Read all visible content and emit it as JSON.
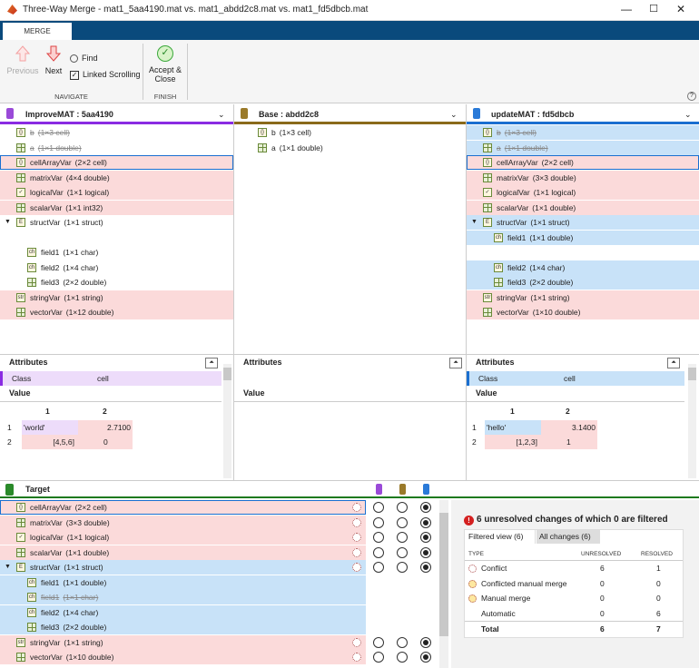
{
  "window": {
    "title": "Three-Way Merge - mat1_5aa4190.mat vs. mat1_abdd2c8.mat vs. mat1_fd5dbcb.mat"
  },
  "tabs": {
    "merge": "MERGE"
  },
  "toolbar": {
    "previous": "Previous",
    "next": "Next",
    "find": "Find",
    "linked_scrolling": "Linked Scrolling",
    "accept_close": "Accept &",
    "accept_close2": "Close",
    "navigate": "NAVIGATE",
    "finish": "FINISH"
  },
  "left": {
    "title": "ImproveMAT : 5aa4190",
    "rows": [
      {
        "name": "b",
        "type": "(1×3 cell)",
        "cls": "strike",
        "bg": ""
      },
      {
        "name": "a",
        "type": "(1×1 double)",
        "cls": "strike",
        "bg": ""
      },
      {
        "name": "cellArrayVar",
        "type": "(2×2 cell)",
        "cls": "",
        "bg": "pink"
      },
      {
        "name": "matrixVar",
        "type": "(4×4 double)",
        "cls": "",
        "bg": "pink"
      },
      {
        "name": "logicalVar",
        "type": "(1×1 logical)",
        "cls": "",
        "bg": "pink"
      },
      {
        "name": "scalarVar",
        "type": "(1×1 int32)",
        "cls": "",
        "bg": "pink"
      },
      {
        "name": "structVar",
        "type": "(1×1 struct)",
        "cls": "",
        "bg": ""
      },
      {
        "name": "",
        "type": "",
        "cls": "",
        "bg": ""
      },
      {
        "name": "field1",
        "type": "(1×1 char)",
        "cls": "",
        "bg": ""
      },
      {
        "name": "field2",
        "type": "(1×4 char)",
        "cls": "",
        "bg": ""
      },
      {
        "name": "field3",
        "type": "(2×2 double)",
        "cls": "",
        "bg": ""
      },
      {
        "name": "stringVar",
        "type": "(1×1 string)",
        "cls": "",
        "bg": "pink"
      },
      {
        "name": "vectorVar",
        "type": "(1×12 double)",
        "cls": "",
        "bg": "pink"
      }
    ],
    "attributes": "Attributes",
    "class_label": "Class",
    "class_value": "cell",
    "value_label": "Value",
    "grid_cols": [
      "1",
      "2"
    ],
    "grid_rows": [
      [
        "1",
        "'world'",
        "2.7100"
      ],
      [
        "2",
        "[4,5,6]",
        "0"
      ]
    ]
  },
  "base": {
    "title": "Base : abdd2c8",
    "rows": [
      {
        "name": "b",
        "type": "(1×3 cell)"
      },
      {
        "name": "a",
        "type": "(1×1 double)"
      }
    ],
    "attributes": "Attributes",
    "value_label": "Value"
  },
  "right": {
    "title": "updateMAT : fd5dbcb",
    "rows": [
      {
        "name": "b",
        "type": "(1×3 cell)",
        "cls": "strike",
        "bg": "blue"
      },
      {
        "name": "a",
        "type": "(1×1 double)",
        "cls": "strike",
        "bg": "blue"
      },
      {
        "name": "cellArrayVar",
        "type": "(2×2 cell)",
        "cls": "",
        "bg": "pink"
      },
      {
        "name": "matrixVar",
        "type": "(3×3 double)",
        "cls": "",
        "bg": "pink"
      },
      {
        "name": "logicalVar",
        "type": "(1×1 logical)",
        "cls": "",
        "bg": "pink"
      },
      {
        "name": "scalarVar",
        "type": "(1×1 double)",
        "cls": "",
        "bg": "pink"
      },
      {
        "name": "structVar",
        "type": "(1×1 struct)",
        "cls": "",
        "bg": "blue"
      },
      {
        "name": "field1",
        "type": "(1×1 double)",
        "cls": "",
        "bg": "blue"
      },
      {
        "name": "",
        "type": "",
        "cls": "",
        "bg": ""
      },
      {
        "name": "field2",
        "type": "(1×4 char)",
        "cls": "",
        "bg": "blue"
      },
      {
        "name": "field3",
        "type": "(2×2 double)",
        "cls": "",
        "bg": "blue"
      },
      {
        "name": "stringVar",
        "type": "(1×1 string)",
        "cls": "",
        "bg": "pink"
      },
      {
        "name": "vectorVar",
        "type": "(1×10 double)",
        "cls": "",
        "bg": "pink"
      }
    ],
    "attributes": "Attributes",
    "class_label": "Class",
    "class_value": "cell",
    "value_label": "Value",
    "grid_cols": [
      "1",
      "2"
    ],
    "grid_rows": [
      [
        "1",
        "'hello'",
        "3.1400"
      ],
      [
        "2",
        "[1,2,3]",
        "1"
      ]
    ]
  },
  "target": {
    "title": "Target",
    "rows": [
      {
        "name": "cellArrayVar",
        "type": "(2×2 cell)",
        "cls": "",
        "bg": "pink",
        "sel": 2
      },
      {
        "name": "matrixVar",
        "type": "(3×3 double)",
        "cls": "",
        "bg": "pink",
        "sel": 2
      },
      {
        "name": "logicalVar",
        "type": "(1×1 logical)",
        "cls": "",
        "bg": "pink",
        "sel": 2
      },
      {
        "name": "scalarVar",
        "type": "(1×1 double)",
        "cls": "",
        "bg": "pink",
        "sel": 2
      },
      {
        "name": "structVar",
        "type": "(1×1 struct)",
        "cls": "",
        "bg": "blue",
        "sel": 2
      },
      {
        "name": "field1",
        "type": "(1×1 double)",
        "cls": "",
        "bg": "blue",
        "sel": -1
      },
      {
        "name": "field1",
        "type": "(1×1 char)",
        "cls": "strike",
        "bg": "blue",
        "sel": -1
      },
      {
        "name": "field2",
        "type": "(1×4 char)",
        "cls": "",
        "bg": "blue",
        "sel": -1
      },
      {
        "name": "field3",
        "type": "(2×2 double)",
        "cls": "",
        "bg": "blue",
        "sel": -1
      },
      {
        "name": "stringVar",
        "type": "(1×1 string)",
        "cls": "",
        "bg": "pink",
        "sel": 2
      },
      {
        "name": "vectorVar",
        "type": "(1×10 double)",
        "cls": "",
        "bg": "pink",
        "sel": 2
      }
    ]
  },
  "summary": {
    "headline": "6 unresolved changes of which 0 are filtered",
    "tab_filtered": "Filtered view (6)",
    "tab_all": "All changes (6)",
    "col_type": "TYPE",
    "col_unresolved": "UNRESOLVED",
    "col_resolved": "RESOLVED",
    "rows": [
      {
        "type": "Conflict",
        "unresolved": "6",
        "resolved": "1"
      },
      {
        "type": "Conflicted manual merge",
        "unresolved": "0",
        "resolved": "0"
      },
      {
        "type": "Manual merge",
        "unresolved": "0",
        "resolved": "0"
      },
      {
        "type": "Automatic",
        "unresolved": "0",
        "resolved": "6"
      }
    ],
    "total_label": "Total",
    "total_unresolved": "6",
    "total_resolved": "7"
  },
  "colors": {
    "accent": "#0a4a7c",
    "left": "#8a2be2",
    "base": "#8a6a1a",
    "right": "#1a6fd0",
    "target": "#1e7a1e",
    "conflict": "#fbdada",
    "change": "#c8e2f8"
  }
}
